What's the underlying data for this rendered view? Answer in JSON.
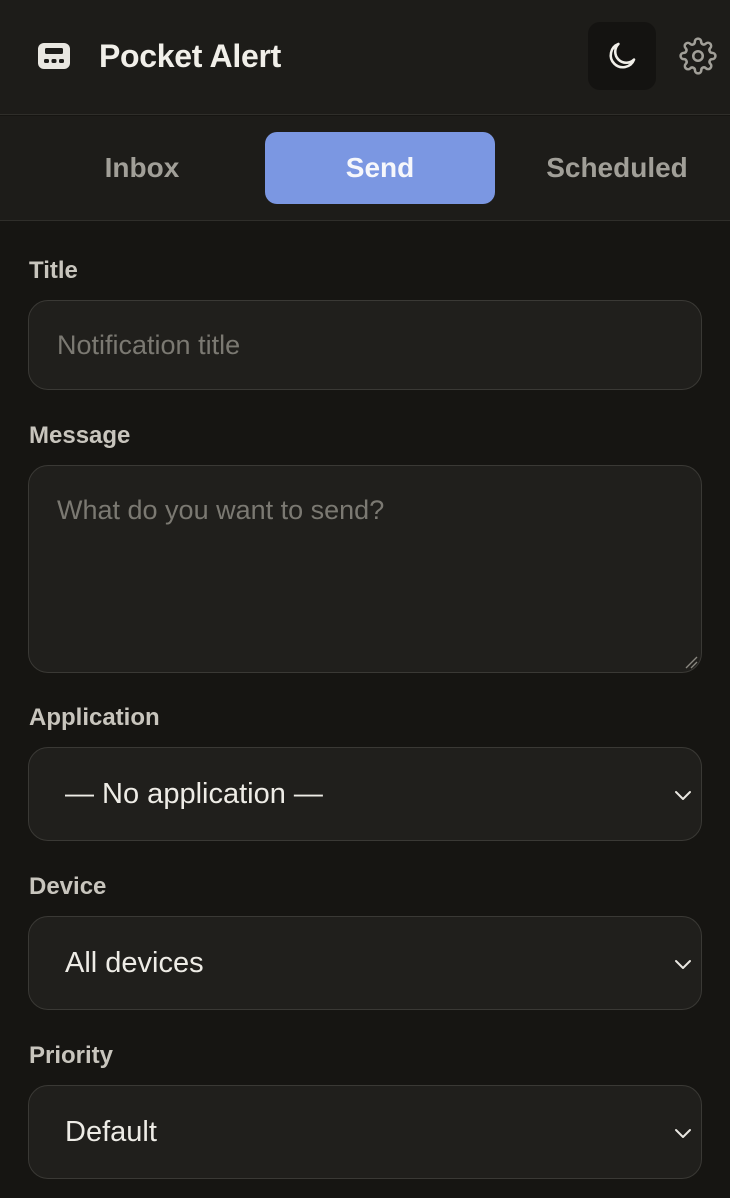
{
  "header": {
    "app_title": "Pocket Alert",
    "app_icon": "pager-icon",
    "theme_icon": "moon-icon",
    "settings_icon": "gear-icon"
  },
  "tabs": [
    {
      "label": "Inbox",
      "active": false
    },
    {
      "label": "Send",
      "active": true
    },
    {
      "label": "Scheduled",
      "active": false
    }
  ],
  "form": {
    "title_label": "Title",
    "title_placeholder": "Notification title",
    "message_label": "Message",
    "message_placeholder": "What do you want to send?",
    "application_label": "Application",
    "application_value": "— No application —",
    "device_label": "Device",
    "device_value": "All devices",
    "priority_label": "Priority",
    "priority_value": "Default"
  },
  "colors": {
    "accent": "#7b97e2",
    "background": "#161512",
    "surface": "#1d1c19"
  }
}
